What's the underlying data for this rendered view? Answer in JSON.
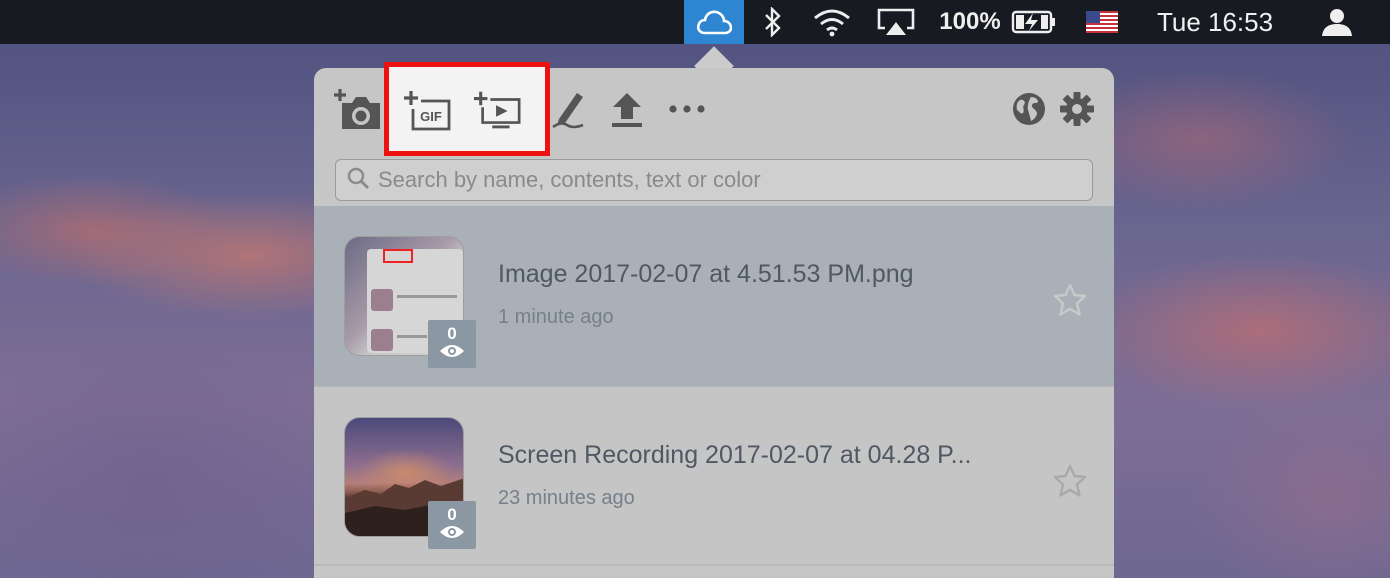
{
  "menubar": {
    "battery_percent": "100%",
    "clock": "Tue 16:53",
    "icons": [
      "cloud-icon",
      "bluetooth-icon",
      "wifi-icon",
      "airplay-icon",
      "battery-charging-icon",
      "us-flag-icon",
      "user-icon"
    ],
    "accent_color": "#2e86d3"
  },
  "toolbar": {
    "buttons": [
      "camera-plus-icon",
      "gif-plus-icon",
      "screen-record-plus-icon",
      "annotate-icon",
      "upload-icon",
      "more-icon",
      "globe-icon",
      "gear-icon"
    ],
    "gif_glyph": "GIF",
    "more_glyph": "•••",
    "highlight_color": "#ee1111"
  },
  "search": {
    "placeholder": "Search by name, contents, text or color"
  },
  "items": [
    {
      "title": "Image 2017-02-07 at 4.51.53 PM.png",
      "time": "1 minute ago",
      "views": "0",
      "selected": true
    },
    {
      "title": "Screen Recording 2017-02-07 at 04.28 P...",
      "time": "23 minutes ago",
      "views": "0",
      "selected": false
    }
  ]
}
